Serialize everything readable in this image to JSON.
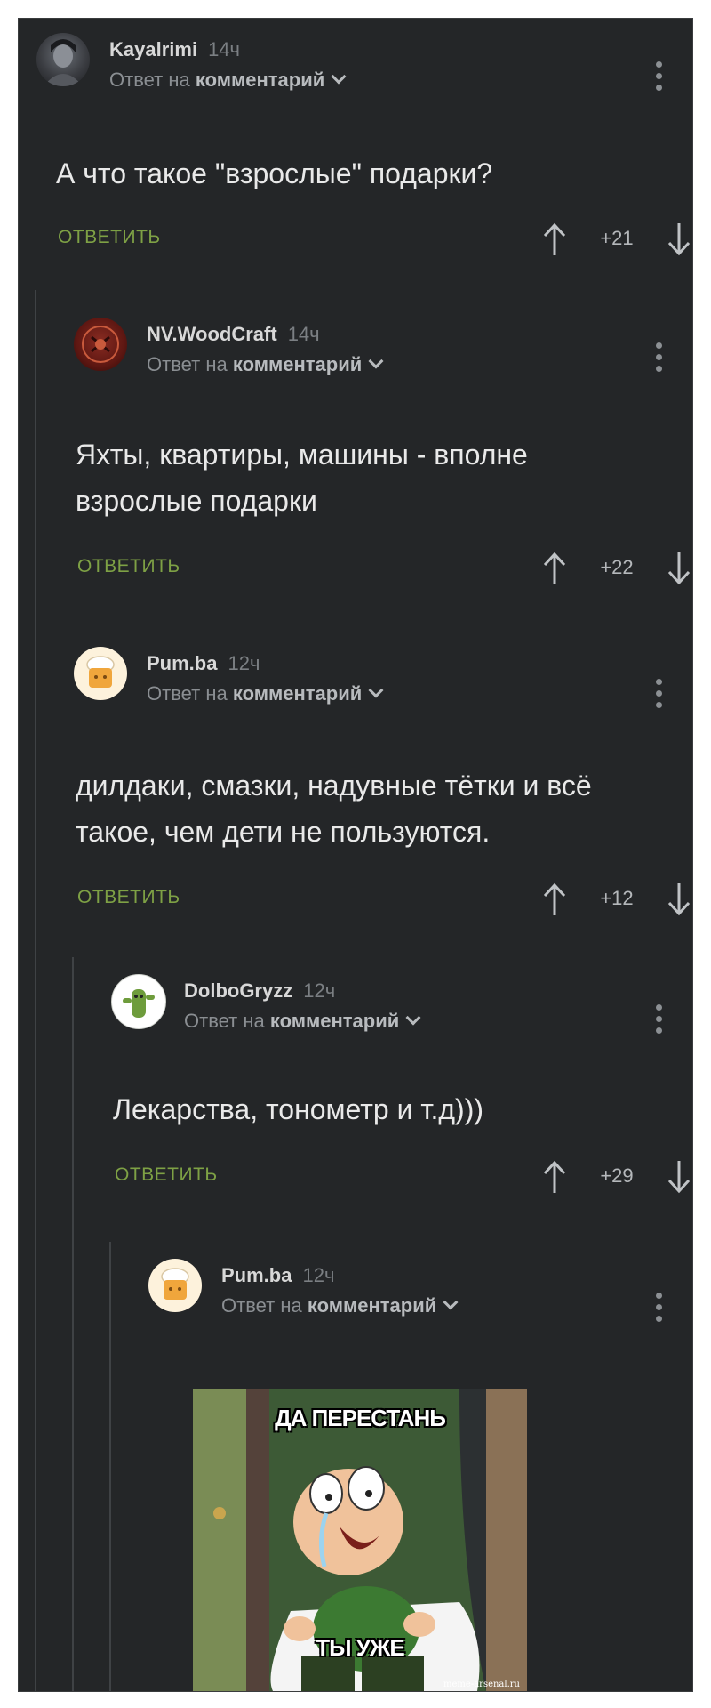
{
  "comments": [
    {
      "author": "Kayalrimi",
      "time": "14ч",
      "reply_prefix": "Ответ на",
      "reply_target": "комментарий",
      "text": "А что такое \"взрослые\" подарки?",
      "reply_label": "ОТВЕТИТЬ",
      "score": "+21",
      "avatar": "dark-portrait-avatar"
    },
    {
      "author": "NV.WoodCraft",
      "time": "14ч",
      "reply_prefix": "Ответ на",
      "reply_target": "комментарий",
      "text": "Яхты, квартиры, машины - вполне взрослые подарки",
      "reply_label": "ОТВЕТИТЬ",
      "score": "+22",
      "avatar": "red-ornament-avatar"
    },
    {
      "author": "Pum.ba",
      "time": "12ч",
      "reply_prefix": "Ответ на",
      "reply_target": "комментарий",
      "text": "дилдаки, смазки, надувные тётки и всё такое, чем дети не пользуются.",
      "reply_label": "ОТВЕТИТЬ",
      "score": "+12",
      "avatar": "chef-hat-avatar"
    },
    {
      "author": "DolboGryzz",
      "time": "12ч",
      "reply_prefix": "Ответ на",
      "reply_target": "комментарий",
      "text": "Лекарства, тонометр и т.д)))",
      "reply_label": "ОТВЕТИТЬ",
      "score": "+29",
      "avatar": "green-cactus-avatar"
    },
    {
      "author": "Pum.ba",
      "time": "12ч",
      "reply_prefix": "Ответ на",
      "reply_target": "комментарий",
      "avatar": "chef-hat-avatar"
    }
  ],
  "meme": {
    "top_text": "ДА ПЕРЕСТАНЬ",
    "bottom_text": "ТЫ УЖЕ",
    "watermark": "meme-arsenal.ru"
  },
  "colors": {
    "background": "#242628",
    "reply_button": "#7ea145",
    "text": "#e9e9e9",
    "muted": "#8a8e92"
  }
}
